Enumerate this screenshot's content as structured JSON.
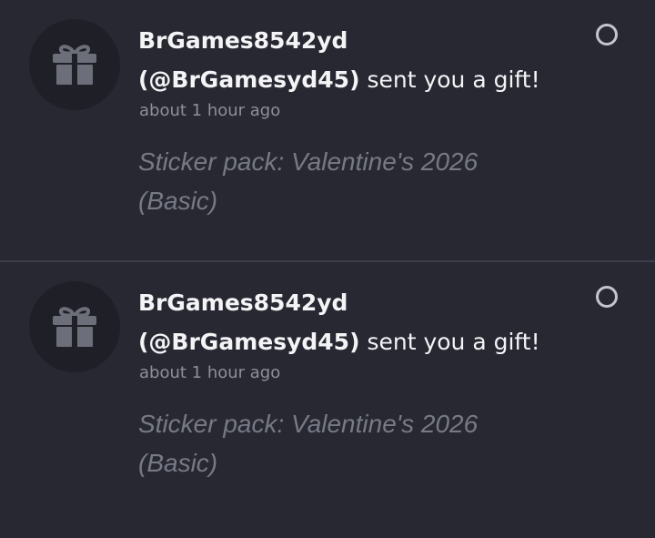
{
  "notifications": [
    {
      "sender_name": "BrGames8542yd",
      "sender_handle": "(@BrGamesyd45)",
      "action": " sent you a gift!",
      "time": "about 1 hour ago",
      "body": "Sticker pack: Valentine's 2026 (Basic)",
      "icon": "gift-icon"
    },
    {
      "sender_name": "BrGames8542yd",
      "sender_handle": "(@BrGamesyd45)",
      "action": " sent you a gift!",
      "time": "about 1 hour ago",
      "body": "Sticker pack: Valentine's 2026 (Basic)",
      "icon": "gift-icon"
    }
  ],
  "colors": {
    "background": "#272832",
    "avatar_bg": "#1e1f27",
    "title": "#f4f4f6",
    "time": "#8d8f9a",
    "body": "#777a85",
    "divider": "#3d3e49",
    "unread_ring": "#c4c5cc"
  }
}
